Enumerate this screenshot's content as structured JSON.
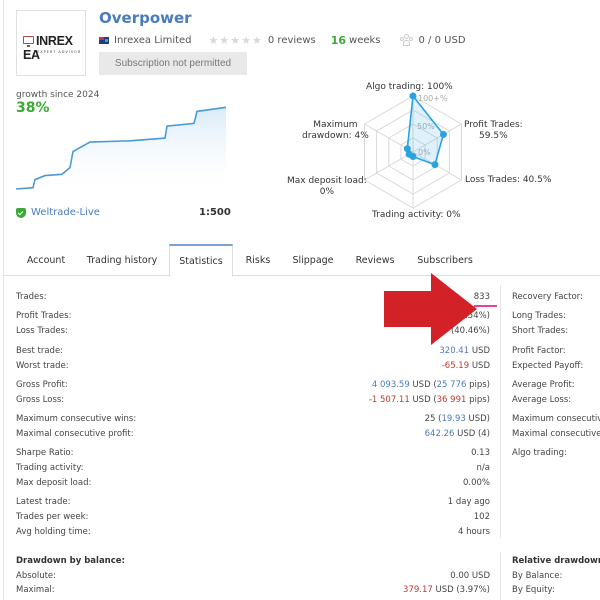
{
  "header": {
    "logo_text": "INREX EA",
    "logo_subtext": "EXPERT ADVISOR",
    "title": "Overpower",
    "provider": "Inrexea Limited",
    "rating_stars": 0,
    "reviews": "0 reviews",
    "weeks_num": "16",
    "weeks_label": "weeks",
    "subscribers": "0 / 0 USD",
    "subscribe_button": "Subscription not permitted"
  },
  "growth": {
    "label": "growth since 2024",
    "value": "38%",
    "broker": "Weltrade-Live",
    "leverage": "1:500"
  },
  "radar": {
    "labels": {
      "algo": "Algo trading: 100%",
      "profit_1": "Profit Trades:",
      "profit_2": "59.5%",
      "loss": "Loss Trades: 40.5%",
      "activity": "Trading activity: 0%",
      "deposit_1": "Max deposit load:",
      "deposit_2": "0%",
      "drawdown_1": "Maximum",
      "drawdown_2": "drawdown: 4%"
    },
    "ring_labels": [
      "100+%",
      "50%",
      "0%"
    ]
  },
  "chart_data": {
    "type": "radar",
    "title": "",
    "axes": [
      "Algo trading",
      "Profit Trades",
      "Loss Trades",
      "Trading activity",
      "Max deposit load",
      "Maximum drawdown"
    ],
    "values": [
      100,
      59.5,
      40.5,
      0,
      0,
      4
    ],
    "range": [
      0,
      100
    ],
    "rings": [
      "0%",
      "50%",
      "100+%"
    ]
  },
  "growth_chart": {
    "type": "line",
    "title": "growth since 2024",
    "end_value_percent": 38,
    "series_shape": [
      0,
      0.5,
      3.5,
      5,
      5.5,
      8,
      14,
      16.5,
      17.5,
      18,
      19,
      23.5,
      24.5,
      29,
      30.5
    ]
  },
  "tabs": [
    {
      "label": "Account",
      "active": false
    },
    {
      "label": "Trading history",
      "active": false
    },
    {
      "label": "Statistics",
      "active": true
    },
    {
      "label": "Risks",
      "active": false
    },
    {
      "label": "Slippage",
      "active": false
    },
    {
      "label": "Reviews",
      "active": false
    },
    {
      "label": "Subscribers",
      "active": false
    }
  ],
  "stats": {
    "trades_label": "Trades:",
    "trades_value": "833",
    "profit_trades_label": "Profit Trades:",
    "profit_trades_value": "496 (59.54%)",
    "loss_trades_label": "Loss Trades:",
    "loss_trades_value": "337 (40.46%)",
    "best_trade_label": "Best trade:",
    "best_trade_num": "320.41",
    "best_trade_unit": " USD",
    "worst_trade_label": "Worst trade:",
    "worst_trade_num": "-65.19",
    "worst_trade_unit": " USD",
    "gross_profit_label": "Gross Profit:",
    "gross_profit_num": "4 093.59",
    "gross_profit_mid": " USD (",
    "gross_profit_pips": "25 776",
    "gross_profit_end": " pips)",
    "gross_loss_label": "Gross Loss:",
    "gross_loss_num": "-1 507.11",
    "gross_loss_mid": " USD (",
    "gross_loss_pips": "36 991",
    "gross_loss_end": " pips)",
    "max_cons_wins_label": "Maximum consecutive wins:",
    "max_cons_wins_count": "25 (",
    "max_cons_wins_usd": "19.93",
    "max_cons_wins_end": " USD)",
    "max_cons_profit_label": "Maximal consecutive profit:",
    "max_cons_profit_num": "642.26",
    "max_cons_profit_end": " USD (4)",
    "sharpe_label": "Sharpe Ratio:",
    "sharpe_value": "0.13",
    "trading_activity_label": "Trading activity:",
    "trading_activity_value": "n/a",
    "max_deposit_load_label": "Max deposit load:",
    "max_deposit_load_value": "0.00%",
    "latest_trade_label": "Latest trade:",
    "latest_trade_value": "1 day ago",
    "trades_per_week_label": "Trades per week:",
    "trades_per_week_value": "102",
    "avg_holding_label": "Avg holding time:",
    "avg_holding_value": "4 hours"
  },
  "stats_right": {
    "recovery_factor": "Recovery Factor:",
    "long_trades": "Long Trades:",
    "short_trades": "Short Trades:",
    "profit_factor": "Profit Factor:",
    "expected_payoff": "Expected Payoff:",
    "average_profit": "Average Profit:",
    "average_loss": "Average Loss:",
    "max_cons_losses": "Maximum consecutive l",
    "max_cons_loss": "Maximal consecutive lo",
    "algo_trading": "Algo trading:"
  },
  "drawdown": {
    "title": "Drawdown by balance:",
    "absolute_label": "Absolute:",
    "absolute_value": "0.00 USD",
    "maximal_label": "Maximal:",
    "maximal_num": "379.17",
    "maximal_end": " USD (3.97%)",
    "relative_title": "Relative drawdown:",
    "by_balance": "By Balance:",
    "by_equity": "By Equity:"
  },
  "colors": {
    "accent_blue": "#4a7bbf",
    "positive_green": "#3aaa35",
    "negative_red": "#c0392b",
    "highlight_pink": "#e84393",
    "arrow_red": "#d32128",
    "radar_line": "#29a3e0"
  }
}
